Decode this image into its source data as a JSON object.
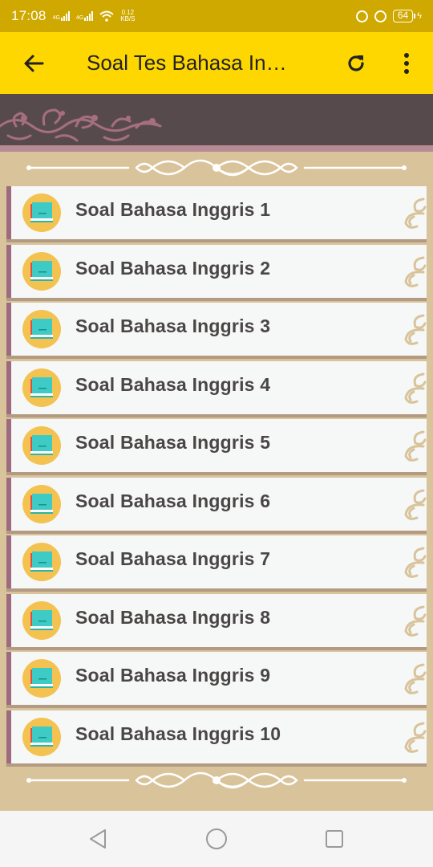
{
  "status_bar": {
    "time": "17:08",
    "sim1_label": "4G",
    "sim2_label": "4G",
    "speed_value": "0.12",
    "speed_unit": "KB/S",
    "battery": "64"
  },
  "app_bar": {
    "title": "Soal Tes Bahasa In…",
    "back_icon": "arrow-back-icon",
    "refresh_icon": "refresh-icon",
    "more_icon": "more-vert-icon"
  },
  "list": {
    "items": [
      {
        "label": "Soal Bahasa Inggris 1"
      },
      {
        "label": "Soal Bahasa Inggris 2"
      },
      {
        "label": "Soal Bahasa Inggris 3"
      },
      {
        "label": "Soal Bahasa Inggris 4"
      },
      {
        "label": "Soal Bahasa Inggris 5"
      },
      {
        "label": "Soal Bahasa Inggris 6"
      },
      {
        "label": "Soal Bahasa Inggris 7"
      },
      {
        "label": "Soal Bahasa Inggris 8"
      },
      {
        "label": "Soal Bahasa Inggris 9"
      },
      {
        "label": "Soal Bahasa Inggris 10"
      }
    ]
  },
  "nav_bar": {
    "back_icon": "nav-back-icon",
    "home_icon": "nav-home-icon",
    "recents_icon": "nav-recents-icon"
  },
  "colors": {
    "status_bar": "#cfa800",
    "app_bar": "#ffd700",
    "background": "#d9c39b",
    "header_band": "#574a4d",
    "item_border": "#9d6b7d",
    "item_text": "#4b4646"
  }
}
